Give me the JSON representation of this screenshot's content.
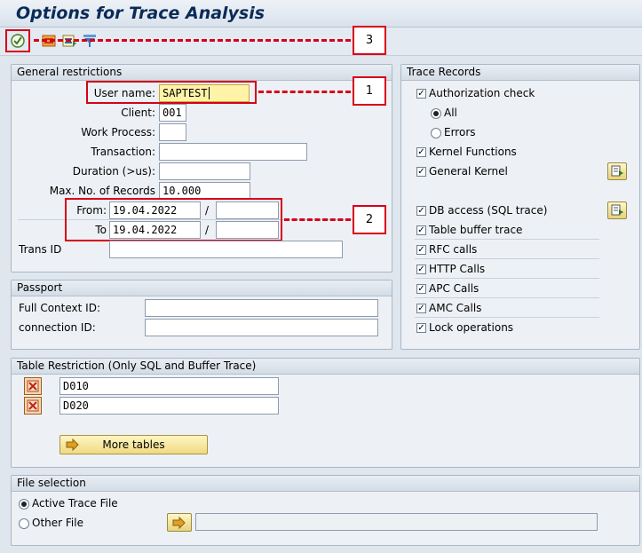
{
  "window": {
    "title": "Options for Trace Analysis"
  },
  "toolbar": {
    "icons": [
      "execute-icon",
      "trace-list-icon",
      "display-icon",
      "filter-icon"
    ]
  },
  "callouts": {
    "one": "1",
    "two": "2",
    "three": "3"
  },
  "general": {
    "header": "General restrictions",
    "user_label": "User name:",
    "user_value": "SAPTEST",
    "client_label": "Client:",
    "client_value": "001",
    "workprocess_label": "Work Process:",
    "workprocess_value": "",
    "transaction_label": "Transaction:",
    "transaction_value": "",
    "duration_label": "Duration (>us):",
    "duration_value": "",
    "maxrec_label": "Max. No. of Records",
    "maxrec_value": "10.000",
    "from_label": "From:",
    "from_date": "19.04.2022",
    "from_time": "",
    "to_label": "To",
    "to_date": "19.04.2022",
    "to_time": "",
    "slash": "/",
    "transid_label": "Trans ID",
    "transid_value": ""
  },
  "passport": {
    "header": "Passport",
    "context_label": "Full Context ID:",
    "context_value": "",
    "connection_label": "connection ID:",
    "connection_value": ""
  },
  "records": {
    "header": "Trace Records",
    "auth": "Authorization check",
    "all": "All",
    "errors": "Errors",
    "kernel": "Kernel Functions",
    "general_kernel": "General Kernel",
    "db": "DB access (SQL trace)",
    "table_buffer": "Table buffer trace",
    "rfc": "RFC calls",
    "http": "HTTP Calls",
    "apc": "APC Calls",
    "amc": "AMC Calls",
    "lock": "Lock operations"
  },
  "tables": {
    "header": "Table Restriction (Only SQL and Buffer Trace)",
    "table1": "D010",
    "table2": "D020",
    "more_label": "More tables"
  },
  "file": {
    "header": "File selection",
    "active": "Active Trace File",
    "other": "Other File",
    "path_value": ""
  }
}
